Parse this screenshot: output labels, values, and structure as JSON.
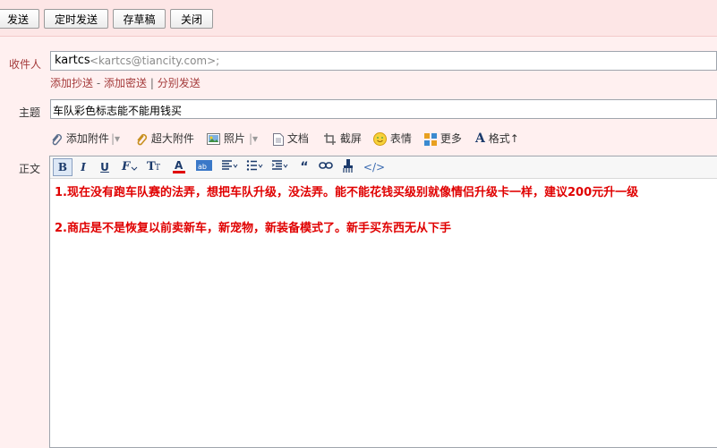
{
  "toolbar": {
    "send": "发送",
    "scheduled_send": "定时发送",
    "save_draft": "存草稿",
    "close": "关闭"
  },
  "form": {
    "recipient_label": "收件人",
    "recipient_name": "kartcs",
    "recipient_address": "<kartcs@tiancity.com>;",
    "add_cc": "添加抄送",
    "dash": "-",
    "add_bcc": "添加密送",
    "pipe": "|",
    "separate_send": "分别发送",
    "subject_label": "主题",
    "subject_value": "车队彩色标志能不能用钱买",
    "body_label": "正文"
  },
  "attachments": {
    "add_attachment": "添加附件",
    "large_attachment": "超大附件",
    "photo": "照片",
    "document": "文档",
    "screenshot": "截屏",
    "emoticon": "表情",
    "more": "更多",
    "format": "格式↑"
  },
  "editor_toolbar": {
    "bold": "B",
    "italic": "I",
    "underline": "U",
    "html": "</>"
  },
  "body": {
    "line1": "1.现在没有跑车队赛的法弄，想把车队升级，没法弄。能不能花钱买级别就像情侣升级卡一样，建议200元升一级",
    "line2": "2.商店是不是恢复以前卖新车，新宠物，新装备模式了。新手买东西无从下手"
  },
  "colors": {
    "accent_red": "#a43b3b",
    "body_text": "#e00000",
    "background": "#fff0f0"
  }
}
